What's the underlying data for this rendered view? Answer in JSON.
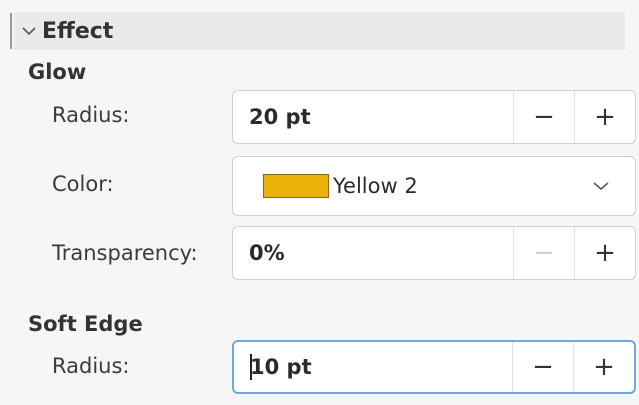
{
  "section": {
    "title": "Effect",
    "toggle_icon": "chevron-down-icon"
  },
  "glow": {
    "title": "Glow",
    "radius": {
      "label": "Radius:",
      "value": "20 pt"
    },
    "color": {
      "label": "Color:",
      "value": "Yellow 2",
      "swatch_color": "#e9b209"
    },
    "transparency": {
      "label": "Transparency:",
      "value": "0%"
    }
  },
  "soft_edge": {
    "title": "Soft Edge",
    "radius": {
      "label": "Radius:",
      "value": "10 pt"
    }
  },
  "buttons": {
    "decrease": "−",
    "increase": "+"
  }
}
